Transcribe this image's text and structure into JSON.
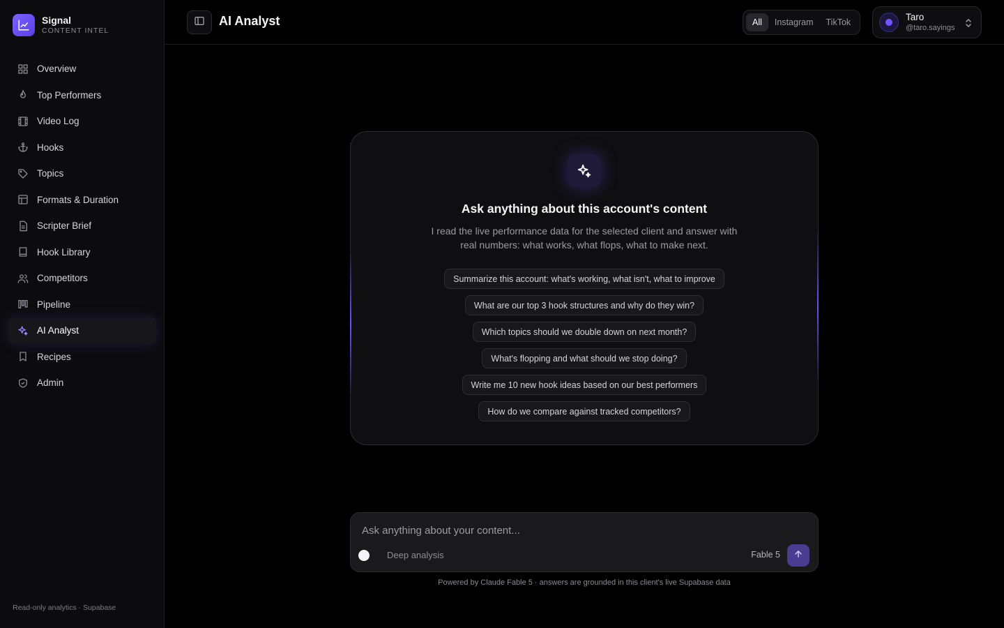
{
  "brand": {
    "name": "Signal",
    "subtitle": "CONTENT INTEL"
  },
  "sidebar": {
    "items": [
      {
        "label": "Overview",
        "icon": "grid-icon"
      },
      {
        "label": "Top Performers",
        "icon": "flame-icon"
      },
      {
        "label": "Video Log",
        "icon": "film-icon"
      },
      {
        "label": "Hooks",
        "icon": "anchor-icon"
      },
      {
        "label": "Topics",
        "icon": "tag-icon"
      },
      {
        "label": "Formats & Duration",
        "icon": "layout-icon"
      },
      {
        "label": "Scripter Brief",
        "icon": "document-icon"
      },
      {
        "label": "Hook Library",
        "icon": "book-icon"
      },
      {
        "label": "Competitors",
        "icon": "users-icon"
      },
      {
        "label": "Pipeline",
        "icon": "kanban-icon"
      },
      {
        "label": "AI Analyst",
        "icon": "sparkles-icon",
        "active": true
      },
      {
        "label": "Recipes",
        "icon": "bookmark-icon"
      },
      {
        "label": "Admin",
        "icon": "shield-icon"
      }
    ],
    "footer": "Read-only analytics · Supabase"
  },
  "header": {
    "title": "AI Analyst",
    "platform_filter": {
      "options": [
        "All",
        "Instagram",
        "TikTok"
      ],
      "selected": "All"
    },
    "account": {
      "name": "Taro",
      "handle": "@taro.sayings"
    }
  },
  "assistant": {
    "title": "Ask anything about this account's content",
    "description": "I read the live performance data for the selected client and answer with real numbers: what works, what flops, what to make next.",
    "suggestions": [
      "Summarize this account: what's working, what isn't, what to improve",
      "What are our top 3 hook structures and why do they win?",
      "Which topics should we double down on next month?",
      "What's flopping and what should we stop doing?",
      "Write me 10 new hook ideas based on our best performers",
      "How do we compare against tracked competitors?"
    ]
  },
  "composer": {
    "placeholder": "Ask anything about your content...",
    "deep_analysis_label": "Deep analysis",
    "model_label": "Fable 5"
  },
  "footer_note": "Powered by Claude Fable 5 · answers are grounded in this client's live Supabase data",
  "colors": {
    "accent": "#6f56ff",
    "background": "#000000",
    "sidebar": "#0c0c0e",
    "card": "#0f0f11"
  }
}
